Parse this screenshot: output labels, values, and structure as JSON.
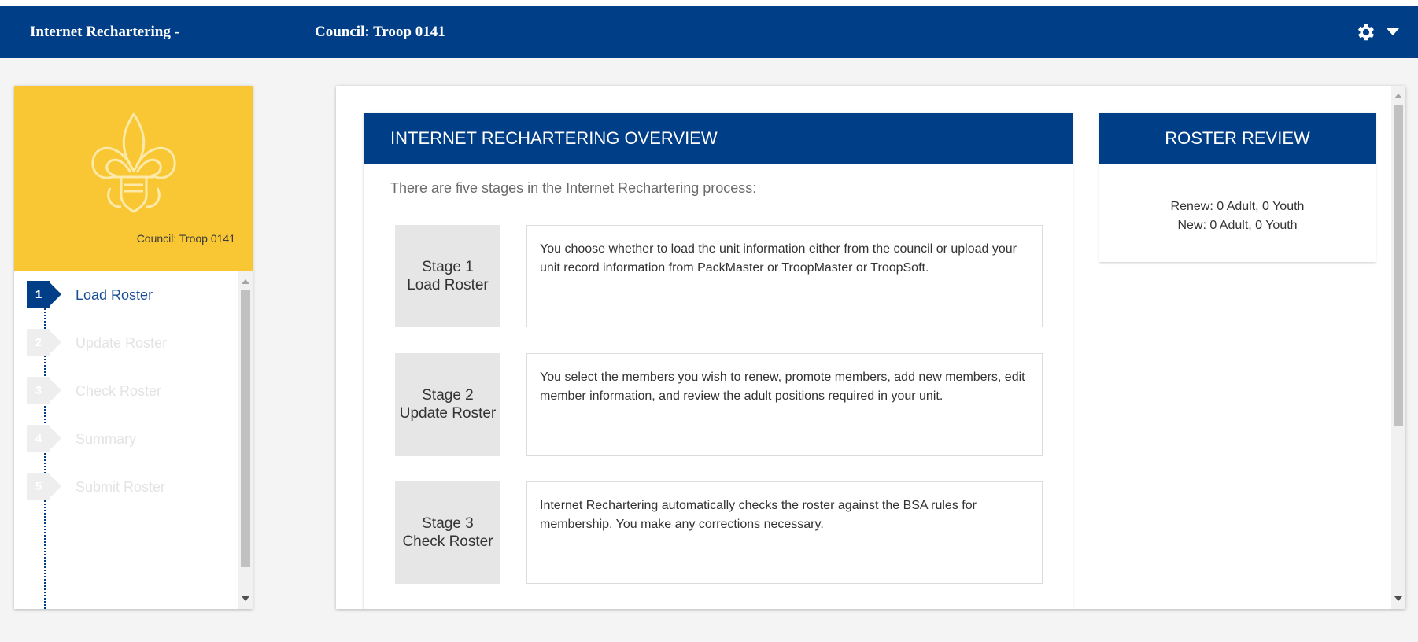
{
  "header": {
    "app_title": "Internet Rechartering -",
    "council": "Council: Troop 0141",
    "settings_icon": "gear-icon",
    "dropdown_icon": "caret-down-icon"
  },
  "sidebar": {
    "logo_icon": "bsa-fleur-de-lis-logo",
    "council": "Council: Troop 0141",
    "steps": [
      {
        "number": "1",
        "label": "Load Roster",
        "active": true
      },
      {
        "number": "2",
        "label": "Update Roster",
        "active": false
      },
      {
        "number": "3",
        "label": "Check Roster",
        "active": false
      },
      {
        "number": "4",
        "label": "Summary",
        "active": false
      },
      {
        "number": "5",
        "label": "Submit Roster",
        "active": false
      }
    ]
  },
  "overview": {
    "title": "INTERNET RECHARTERING OVERVIEW",
    "intro": "There are five stages in the Internet Rechartering process:",
    "stages": [
      {
        "stage": "Stage 1",
        "name": "Load Roster",
        "description": "You choose whether to load the unit information either from the council or upload your unit record information from PackMaster or TroopMaster or TroopSoft."
      },
      {
        "stage": "Stage 2",
        "name": "Update Roster",
        "description": "You select the members you wish to renew, promote members, add new members, edit member information, and review the adult positions required in your unit."
      },
      {
        "stage": "Stage 3",
        "name": "Check Roster",
        "description": "Internet Rechartering automatically checks the roster against the BSA rules for membership. You make any corrections necessary."
      }
    ]
  },
  "roster_review": {
    "title": "ROSTER REVIEW",
    "renew": "Renew: 0 Adult, 0 Youth",
    "new": "New: 0 Adult, 0 Youth"
  },
  "colors": {
    "primary": "#003f87",
    "accent": "#f9c634",
    "stage_box": "#e6e6e6"
  }
}
